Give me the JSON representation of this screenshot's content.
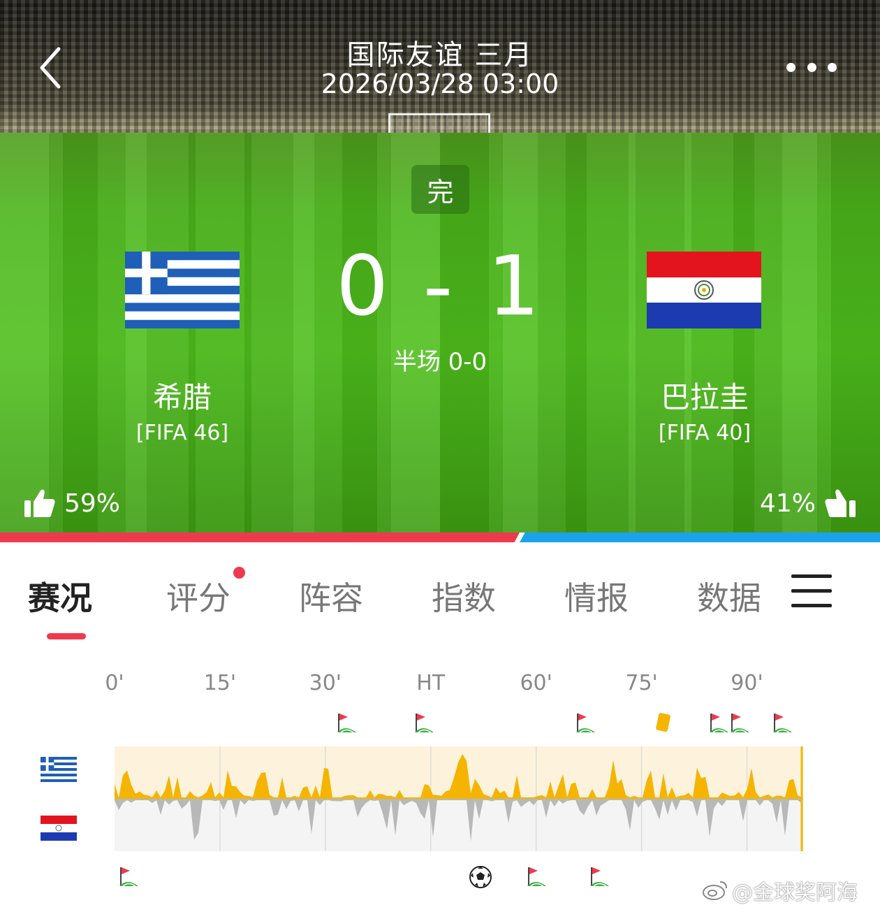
{
  "header": {
    "title": "国际友谊 三月",
    "datetime": "2026/03/28 03:00"
  },
  "match": {
    "status": "完",
    "score": "0 - 1",
    "halftime": "半场 0-0",
    "home": {
      "name": "希腊",
      "rank": "[FIFA 46]",
      "vote": "59%",
      "flag": "greece-flag"
    },
    "away": {
      "name": "巴拉圭",
      "rank": "[FIFA 40]",
      "vote": "41%",
      "flag": "paraguay-flag"
    }
  },
  "vote_bar": {
    "home_fraction": 0.59,
    "away_fraction": 0.41,
    "home_color": "#ee3a4f",
    "away_color": "#1aa3ec"
  },
  "tabs": [
    {
      "label": "赛况",
      "active": true
    },
    {
      "label": "评分",
      "badge_dot": true
    },
    {
      "label": "阵容"
    },
    {
      "label": "指数"
    },
    {
      "label": "情报"
    },
    {
      "label": "数据"
    }
  ],
  "timeline": {
    "ticks": [
      "0'",
      "15'",
      "30'",
      "HT",
      "60'",
      "75'",
      "90'"
    ],
    "home_events": [
      {
        "type": "corner",
        "minute": 33
      },
      {
        "type": "corner",
        "minute": 44
      },
      {
        "type": "corner",
        "minute": 67
      },
      {
        "type": "yellow-card",
        "minute": 78
      },
      {
        "type": "corner",
        "minute": 86
      },
      {
        "type": "corner",
        "minute": 89
      },
      {
        "type": "corner",
        "minute": 95
      }
    ],
    "away_events": [
      {
        "type": "corner",
        "minute": 2
      },
      {
        "type": "goal",
        "minute": 52
      },
      {
        "type": "corner",
        "minute": 60
      },
      {
        "type": "corner",
        "minute": 69
      }
    ],
    "home_color": "#f5b400",
    "away_color": "#b8b8b8"
  },
  "watermark": "@金球奖阿海"
}
